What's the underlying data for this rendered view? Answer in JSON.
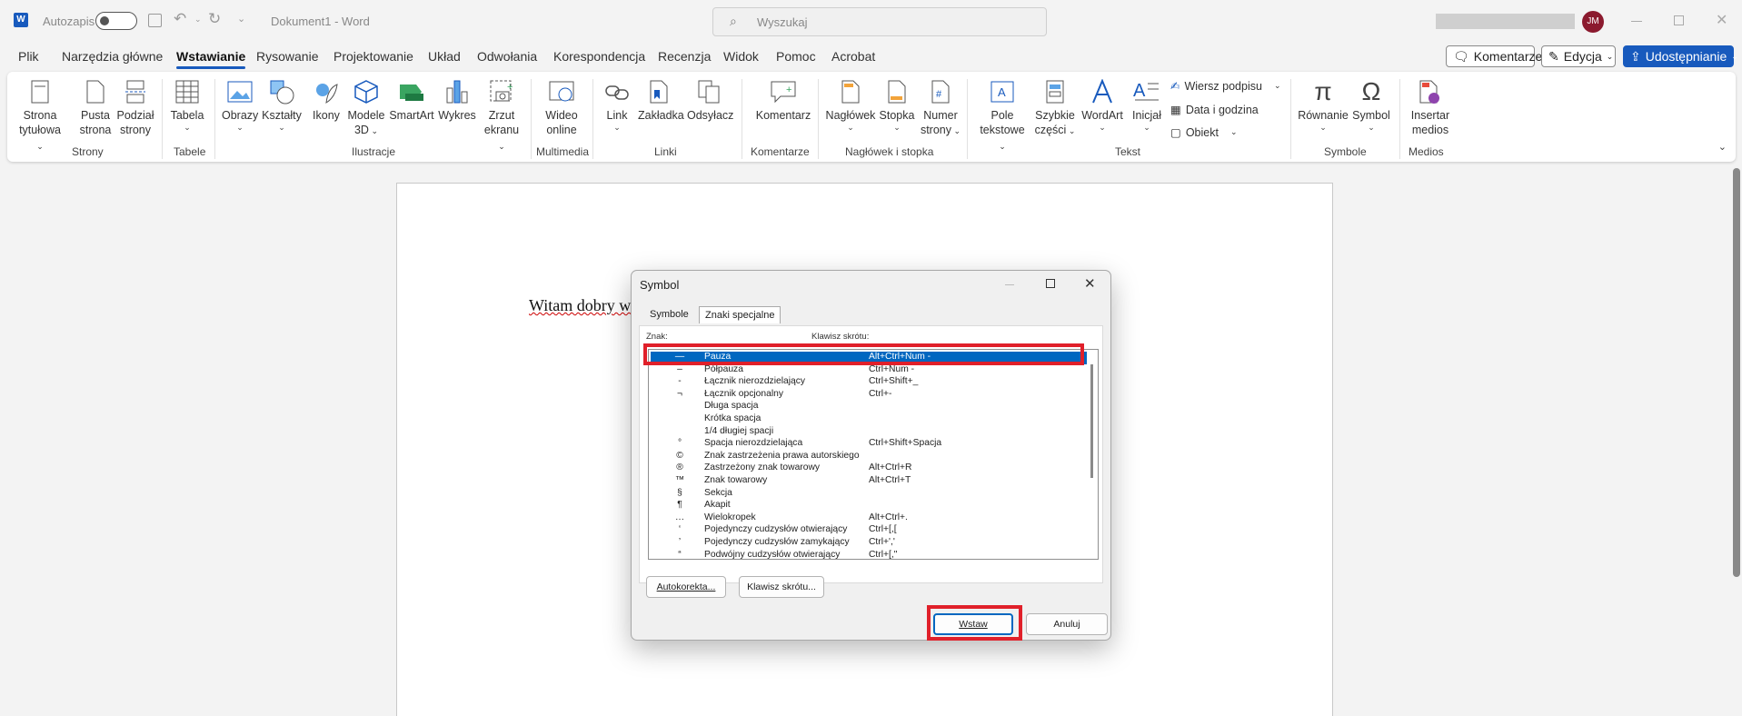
{
  "titlebar": {
    "autosave_label": "Autozapis",
    "doc_title": "Dokument1  -  Word",
    "search_placeholder": "Wyszukaj",
    "user_initials": "JM"
  },
  "menu": [
    "Plik",
    "Narzędzia główne",
    "Wstawianie",
    "Rysowanie",
    "Projektowanie",
    "Układ",
    "Odwołania",
    "Korespondencja",
    "Recenzja",
    "Widok",
    "Pomoc",
    "Acrobat"
  ],
  "top_buttons": {
    "comments": "Komentarze",
    "editing": "Edycja",
    "share": "Udostępnianie"
  },
  "ribbon": {
    "strona_tytulowa": [
      "Strona",
      "tytułowa"
    ],
    "pusta_strona": [
      "Pusta",
      "strona"
    ],
    "podzial_strony": [
      "Podział",
      "strony"
    ],
    "tabela": "Tabela",
    "obrazy": "Obrazy",
    "ksztalty": "Kształty",
    "ikony": "Ikony",
    "modele_3d": [
      "Modele",
      "3D"
    ],
    "smartart": "SmartArt",
    "wykres": "Wykres",
    "zrzut_ekranu": [
      "Zrzut",
      "ekranu"
    ],
    "wideo_online": [
      "Wideo",
      "online"
    ],
    "link": "Link",
    "zakladka": "Zakładka",
    "odsylacz": "Odsyłacz",
    "komentarz": "Komentarz",
    "naglowek": "Nagłówek",
    "stopka": "Stopka",
    "numer_strony": [
      "Numer",
      "strony"
    ],
    "pole_tekstowe": [
      "Pole",
      "tekstowe"
    ],
    "szybkie_czesci": [
      "Szybkie",
      "części"
    ],
    "wordart": "WordArt",
    "inicjal": "Inicjał",
    "wiersz_podpisu": "Wiersz podpisu",
    "data_i_godzina": "Data i godzina",
    "obiekt": "Obiekt",
    "rownanie": "Równanie",
    "symbol": "Symbol",
    "insertar_medios": [
      "Insertar",
      "medios"
    ],
    "groups": {
      "strony": "Strony",
      "tabele": "Tabele",
      "ilustracje": "Ilustracje",
      "multimedia": "Multimedia",
      "linki": "Linki",
      "komentarze": "Komentarze",
      "naglowek_stopka": "Nagłówek i stopka",
      "tekst": "Tekst",
      "symbole": "Symbole",
      "medios": "Medios"
    }
  },
  "document": {
    "text": "Witam dobry w"
  },
  "dialog": {
    "title": "Symbol",
    "tabs": [
      "Symbole",
      "Znaki specjalne"
    ],
    "col_char": "Znak:",
    "col_shortcut": "Klawisz skrótu:",
    "rows": [
      {
        "char": "—",
        "name": "Pauza",
        "shortcut": "Alt+Ctrl+Num -"
      },
      {
        "char": "–",
        "name": "Półpauza",
        "shortcut": "Ctrl+Num -"
      },
      {
        "char": "-",
        "name": "Łącznik nierozdzielający",
        "shortcut": "Ctrl+Shift+_"
      },
      {
        "char": "¬",
        "name": "Łącznik opcjonalny",
        "shortcut": "Ctrl+-"
      },
      {
        "char": "",
        "name": "Długa spacja",
        "shortcut": ""
      },
      {
        "char": "",
        "name": "Krótka spacja",
        "shortcut": ""
      },
      {
        "char": "",
        "name": "1/4 długiej spacji",
        "shortcut": ""
      },
      {
        "char": "°",
        "name": "Spacja nierozdzielająca",
        "shortcut": "Ctrl+Shift+Spacja"
      },
      {
        "char": "©",
        "name": "Znak zastrzeżenia prawa autorskiego",
        "shortcut": ""
      },
      {
        "char": "®",
        "name": "Zastrzeżony znak towarowy",
        "shortcut": "Alt+Ctrl+R"
      },
      {
        "char": "™",
        "name": "Znak towarowy",
        "shortcut": "Alt+Ctrl+T"
      },
      {
        "char": "§",
        "name": "Sekcja",
        "shortcut": ""
      },
      {
        "char": "¶",
        "name": "Akapit",
        "shortcut": ""
      },
      {
        "char": "…",
        "name": "Wielokropek",
        "shortcut": "Alt+Ctrl+."
      },
      {
        "char": "‘",
        "name": "Pojedynczy cudzysłów otwierający",
        "shortcut": "Ctrl+[,["
      },
      {
        "char": "’",
        "name": "Pojedynczy cudzysłów zamykający",
        "shortcut": "Ctrl+','"
      },
      {
        "char": "“",
        "name": "Podwójny cudzysłów otwierający",
        "shortcut": "Ctrl+[,\""
      }
    ],
    "autocorrect_button": "Autokorekta...",
    "shortcut_button": "Klawisz skrótu...",
    "insert_button": "Wstaw",
    "cancel_button": "Anuluj"
  },
  "colors": {
    "accent": "#185abd",
    "highlight": "#0067c0",
    "annotation": "#e0202a"
  }
}
